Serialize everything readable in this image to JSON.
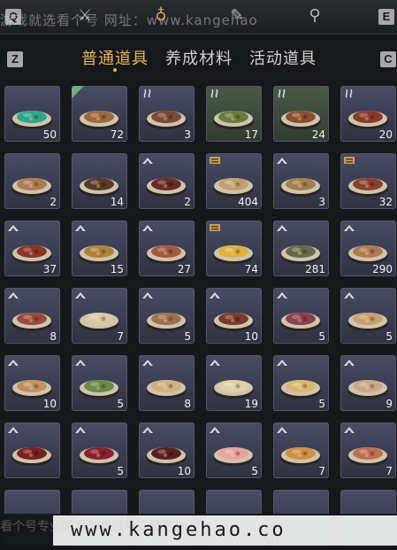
{
  "keys": {
    "left_top": "Q",
    "right_top": "E",
    "left_tab": "Z",
    "right_tab": "C"
  },
  "top_icons": [
    "swords-icon",
    "pouch-icon",
    "scroll-icon",
    "map-pin-icon"
  ],
  "tabs": [
    {
      "label": "普通道具",
      "active": true
    },
    {
      "label": "养成材料",
      "active": false
    },
    {
      "label": "活动道具",
      "active": false
    }
  ],
  "watermark_top": "游戏就选看个号  网址：www.kangehao",
  "watermark_bottom": "看个号专业网易游戏账号交易平台",
  "watermark_url": "www.kangehao.co",
  "items": [
    {
      "count": "50",
      "color": "#2fa58a",
      "badge": "none",
      "tint": "purple"
    },
    {
      "count": "72",
      "color": "#9a6a3a",
      "badge": "green",
      "tint": "purple"
    },
    {
      "count": "3",
      "color": "#7a4a35",
      "badge": "steam",
      "tint": "purple"
    },
    {
      "count": "17",
      "color": "#6a7a3a",
      "badge": "steam",
      "tint": "green"
    },
    {
      "count": "24",
      "color": "#8a5030",
      "badge": "steam",
      "tint": "green"
    },
    {
      "count": "20",
      "color": "#8a3a2a",
      "badge": "steam",
      "tint": "purple"
    },
    {
      "count": "2",
      "color": "#b07a55",
      "badge": "none",
      "tint": "purple"
    },
    {
      "count": "14",
      "color": "#5a3a28",
      "badge": "none",
      "tint": "purple"
    },
    {
      "count": "2",
      "color": "#6a2a25",
      "badge": "up",
      "tint": "purple"
    },
    {
      "count": "404",
      "color": "#c0a070",
      "badge": "gold",
      "tint": "purple"
    },
    {
      "count": "3",
      "color": "#a08050",
      "badge": "up",
      "tint": "purple"
    },
    {
      "count": "32",
      "color": "#8a4030",
      "badge": "gold",
      "tint": "purple"
    },
    {
      "count": "37",
      "color": "#8a3525",
      "badge": "up",
      "tint": "purple"
    },
    {
      "count": "15",
      "color": "#b0803a",
      "badge": "up",
      "tint": "purple"
    },
    {
      "count": "27",
      "color": "#a05a40",
      "badge": "up",
      "tint": "purple"
    },
    {
      "count": "74",
      "color": "#e0b040",
      "badge": "gold",
      "tint": "purple"
    },
    {
      "count": "281",
      "color": "#6a6a4a",
      "badge": "up",
      "tint": "purple"
    },
    {
      "count": "290",
      "color": "#b07a50",
      "badge": "up",
      "tint": "purple"
    },
    {
      "count": "8",
      "color": "#9a4a40",
      "badge": "up",
      "tint": "purple"
    },
    {
      "count": "7",
      "color": "#d8c8a8",
      "badge": "up",
      "tint": "purple"
    },
    {
      "count": "5",
      "color": "#a07050",
      "badge": "up",
      "tint": "purple"
    },
    {
      "count": "10",
      "color": "#7a3a2a",
      "badge": "up",
      "tint": "purple"
    },
    {
      "count": "5",
      "color": "#8a4050",
      "badge": "up",
      "tint": "purple"
    },
    {
      "count": "5",
      "color": "#c8a070",
      "badge": "up",
      "tint": "purple"
    },
    {
      "count": "10",
      "color": "#c09060",
      "badge": "up",
      "tint": "purple"
    },
    {
      "count": "5",
      "color": "#6a8a4a",
      "badge": "up",
      "tint": "purple"
    },
    {
      "count": "8",
      "color": "#d0b080",
      "badge": "up",
      "tint": "purple"
    },
    {
      "count": "19",
      "color": "#e0d0a8",
      "badge": "up",
      "tint": "purple"
    },
    {
      "count": "5",
      "color": "#d8b870",
      "badge": "up",
      "tint": "purple"
    },
    {
      "count": "9",
      "color": "#c8a888",
      "badge": "up",
      "tint": "purple"
    },
    {
      "count": "",
      "color": "#7a2020",
      "badge": "up",
      "tint": "purple"
    },
    {
      "count": "5",
      "color": "#8a2030",
      "badge": "up",
      "tint": "purple"
    },
    {
      "count": "10",
      "color": "#5a2020",
      "badge": "up",
      "tint": "purple"
    },
    {
      "count": "5",
      "color": "#e8a0a0",
      "badge": "up",
      "tint": "purple"
    },
    {
      "count": "7",
      "color": "#d09040",
      "badge": "up",
      "tint": "purple"
    },
    {
      "count": "7",
      "color": "#c07050",
      "badge": "up",
      "tint": "purple"
    }
  ]
}
